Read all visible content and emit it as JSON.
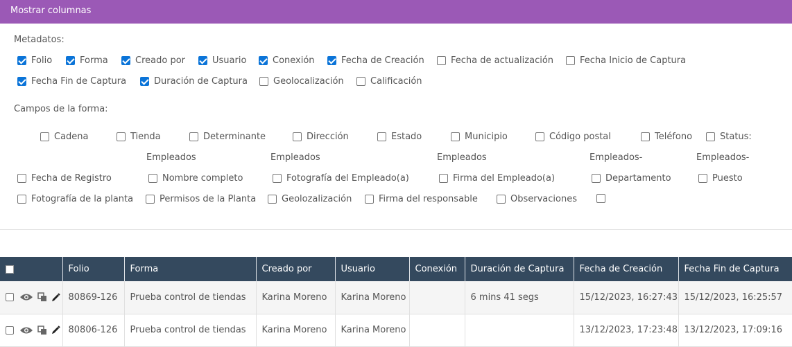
{
  "panel": {
    "title": "Mostrar columnas"
  },
  "metadatos": {
    "label": "Metadatos:",
    "items": [
      {
        "label": "Folio",
        "checked": true
      },
      {
        "label": "Forma",
        "checked": true
      },
      {
        "label": "Creado por",
        "checked": true
      },
      {
        "label": "Usuario",
        "checked": true
      },
      {
        "label": "Conexión",
        "checked": true
      },
      {
        "label": "Fecha de Creación",
        "checked": true
      },
      {
        "label": "Fecha de actualización",
        "checked": false
      },
      {
        "label": "Fecha Inicio de Captura",
        "checked": false
      },
      {
        "label": "Fecha Fin de Captura",
        "checked": true
      },
      {
        "label": "Duración de Captura",
        "checked": true
      },
      {
        "label": "Geolocalización",
        "checked": false
      },
      {
        "label": "Calificación",
        "checked": false
      }
    ]
  },
  "campos": {
    "label": "Campos de la forma:",
    "items": [
      {
        "label": "Cadena",
        "checked": false
      },
      {
        "label": "Tienda",
        "checked": false
      },
      {
        "label": "Determinante",
        "checked": false
      },
      {
        "label": "Dirección",
        "checked": false
      },
      {
        "label": "Estado",
        "checked": false
      },
      {
        "label": "Municipio",
        "checked": false
      },
      {
        "label": "Código postal",
        "checked": false
      },
      {
        "label": "Teléfono",
        "checked": false
      },
      {
        "label": "Status:",
        "checked": false
      },
      {
        "label": "Fecha de Registro",
        "checked": false
      },
      {
        "label": "Nombre completo",
        "checked": false
      },
      {
        "label": "Fotografía del Empleado(a)",
        "checked": false
      },
      {
        "label": "Firma del Empleado(a)",
        "checked": false
      },
      {
        "label": "Departamento",
        "checked": false
      },
      {
        "label": "Puesto",
        "checked": false
      },
      {
        "label": "Fotografía de la planta",
        "checked": false
      },
      {
        "label": "Permisos de la Planta",
        "checked": false
      },
      {
        "label": "Geolozalización",
        "checked": false
      },
      {
        "label": "Firma del responsable",
        "checked": false
      },
      {
        "label": "Observaciones",
        "checked": false
      },
      {
        "label": "",
        "checked": false
      }
    ],
    "sublabels": [
      "Empleados",
      "Empleados",
      "Empleados",
      "Empleados-",
      "Empleados-"
    ]
  },
  "table": {
    "headers": [
      "",
      "Folio",
      "Forma",
      "Creado por",
      "Usuario",
      "Conexión",
      "Duración de Captura",
      "Fecha de Creación",
      "Fecha Fin de Captura"
    ],
    "rows": [
      {
        "folio": "80869-126",
        "forma": "Prueba control de tiendas",
        "creado_por": "Karina Moreno",
        "usuario": "Karina Moreno",
        "conexion": "",
        "duracion": "6 mins 41 segs",
        "fecha_creacion": "15/12/2023, 16:27:43",
        "fecha_fin": "15/12/2023, 16:25:57"
      },
      {
        "folio": "80806-126",
        "forma": "Prueba control de tiendas",
        "creado_por": "Karina Moreno",
        "usuario": "Karina Moreno",
        "conexion": "",
        "duracion": "",
        "fecha_creacion": "13/12/2023, 17:23:48",
        "fecha_fin": "13/12/2023, 17:09:16"
      }
    ]
  },
  "colors": {
    "header_purple": "#9b59b6",
    "table_header": "#34495e",
    "checkbox_blue": "#0b74d8"
  }
}
